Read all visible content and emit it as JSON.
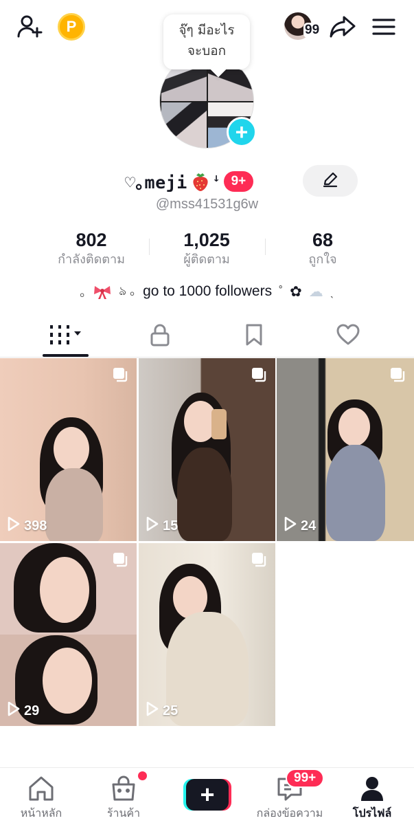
{
  "header": {
    "points_badge": "P",
    "avatar_count": "99",
    "note": {
      "line1": "จุ๊ๆ มีอะไร",
      "line2": "จะบอก"
    }
  },
  "profile": {
    "display_name": "♡｡meji",
    "name_suffix": "ꜜ",
    "name_badge": "9+",
    "username": "@mss41531g6w",
    "stats": [
      {
        "value": "802",
        "label": "กำลังติดตาม"
      },
      {
        "value": "1,025",
        "label": "ผู้ติดตาม"
      },
      {
        "value": "68",
        "label": "ถูกใจ"
      }
    ],
    "bio": {
      "prefix": "｡",
      "mid": "ঌ  ｡",
      "text": "go to 1000 followers",
      "suffix1": "˚",
      "suffix2": "✿",
      "suffix3": "☁",
      "suffix4": "ˎ"
    }
  },
  "tabs": [
    "videos",
    "private",
    "saved",
    "liked"
  ],
  "videos": [
    {
      "plays": "398"
    },
    {
      "plays": "15"
    },
    {
      "plays": "24"
    },
    {
      "plays": "29"
    },
    {
      "plays": "25"
    }
  ],
  "bottom_nav": {
    "home": "หน้าหลัก",
    "shop": "ร้านค้า",
    "create": "+",
    "inbox": "กล่องข้อความ",
    "inbox_badge": "99+",
    "profile": "โปรไฟล์"
  },
  "colors": {
    "accent_red": "#fe2c55",
    "accent_cyan": "#25f4ee",
    "add_photo": "#20d5ec",
    "points": "#ffb400"
  }
}
